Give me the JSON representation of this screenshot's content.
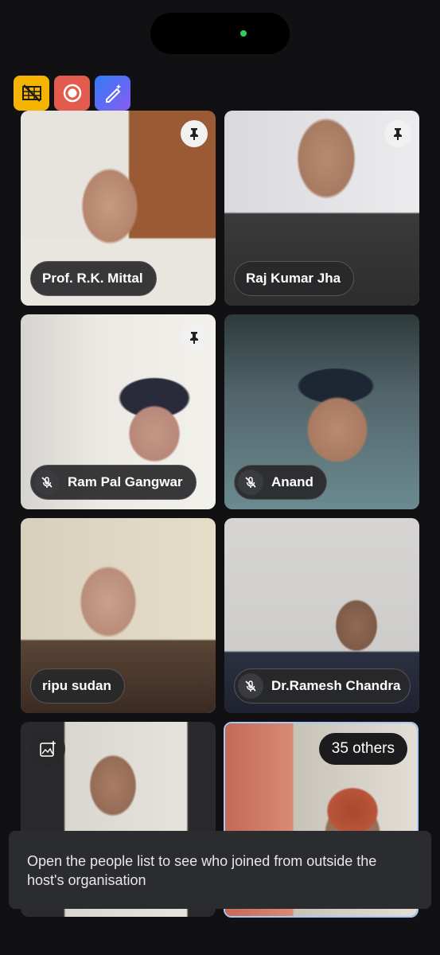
{
  "status": {
    "indicator_color": "#30d158"
  },
  "top_icons": [
    {
      "icon": "no-video-grid-icon",
      "color": "#f5b400"
    },
    {
      "icon": "record-icon",
      "color": "#e25b4d"
    },
    {
      "icon": "magic-pen-icon",
      "color": "#6f6cf3"
    }
  ],
  "tiles": [
    {
      "name": "Prof. R.K. Mittal",
      "pinned": true,
      "muted": false
    },
    {
      "name": "Raj Kumar Jha",
      "pinned": true,
      "muted": false
    },
    {
      "name": "Ram Pal Gangwar",
      "pinned": true,
      "muted": true
    },
    {
      "name": "Anand",
      "pinned": false,
      "muted": true
    },
    {
      "name": "ripu sudan",
      "pinned": false,
      "muted": false
    },
    {
      "name": "Dr.Ramesh Chandra",
      "pinned": false,
      "muted": true
    }
  ],
  "others": {
    "label": "35 others"
  },
  "toast": {
    "message": "Open the people list to see who joined from outside the host's organisation"
  }
}
